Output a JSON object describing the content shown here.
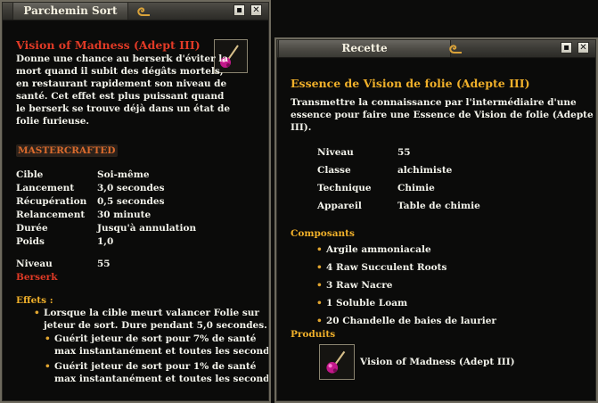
{
  "spell_window": {
    "title": "Parchemin Sort",
    "spell_name": "Vision of Madness (Adept III)",
    "description": "Donne une chance au berserk d'éviter la mort quand il subit des dégâts mortels, en restaurant rapidement son niveau de santé. Cet effet est plus puissant quand le berserk se trouve déjà dans un état de folie furieuse.",
    "description_lines": [
      "Donne une chance au berserk d'éviter la",
      "mort quand il subit des dégâts mortels,",
      "en restaurant rapidement son niveau de",
      "santé. Cet effet est plus puissant quand",
      "le berserk se trouve déjà dans un état de",
      "folie furieuse."
    ],
    "tier": "MASTERCRAFTED",
    "stats": [
      {
        "label": "Cible",
        "value": "Soi-même"
      },
      {
        "label": "Lancement",
        "value": "3,0 secondes"
      },
      {
        "label": "Récupération",
        "value": "0,5 secondes"
      },
      {
        "label": "Relancement",
        "value": "30 minute"
      },
      {
        "label": "Durée",
        "value": "Jusqu'à annulation"
      },
      {
        "label": "Poids",
        "value": "1,0"
      }
    ],
    "level_label": "Niveau",
    "level_value": "55",
    "class_name": "Berserk",
    "effects_label": "Effets :",
    "effect_main_lines": [
      "Lorsque la cible meurt valancer Folie sur",
      "jeteur de sort.  Dure pendant 5,0 secondes."
    ],
    "effect_subs": [
      {
        "lines": [
          "Guérit jeteur de sort pour 7% de santé",
          "max instantanément et toutes les secondes"
        ]
      },
      {
        "lines": [
          "Guérit jeteur de sort pour 1% de santé",
          "max instantanément et toutes les secondes"
        ]
      }
    ],
    "icon": "magic-staff-icon"
  },
  "recipe_window": {
    "title": "Recette",
    "recipe_name": "Essence de Vision de folie (Adepte III)",
    "description_lines": [
      "Transmettre la connaissance par l'intermédiaire d'une",
      "essence pour faire une Essence de Vision de folie (Adepte",
      "III)."
    ],
    "stats": [
      {
        "label": "Niveau",
        "value": "55"
      },
      {
        "label": "Classe",
        "value": "alchimiste"
      },
      {
        "label": "Technique",
        "value": "Chimie"
      },
      {
        "label": "Appareil",
        "value": "Table de chimie"
      }
    ],
    "components_label": "Composants",
    "components": [
      "Argile ammoniacale",
      "4 Raw Succulent Roots",
      "3 Raw Nacre",
      "1 Soluble Loam",
      "20 Chandelle de baies de laurier"
    ],
    "products_label": "Produits",
    "product_name": "Vision of Madness (Adept III)",
    "icon": "magic-staff-icon"
  },
  "controls": {
    "minimize_symbol": "▪",
    "close_symbol": "✕"
  }
}
